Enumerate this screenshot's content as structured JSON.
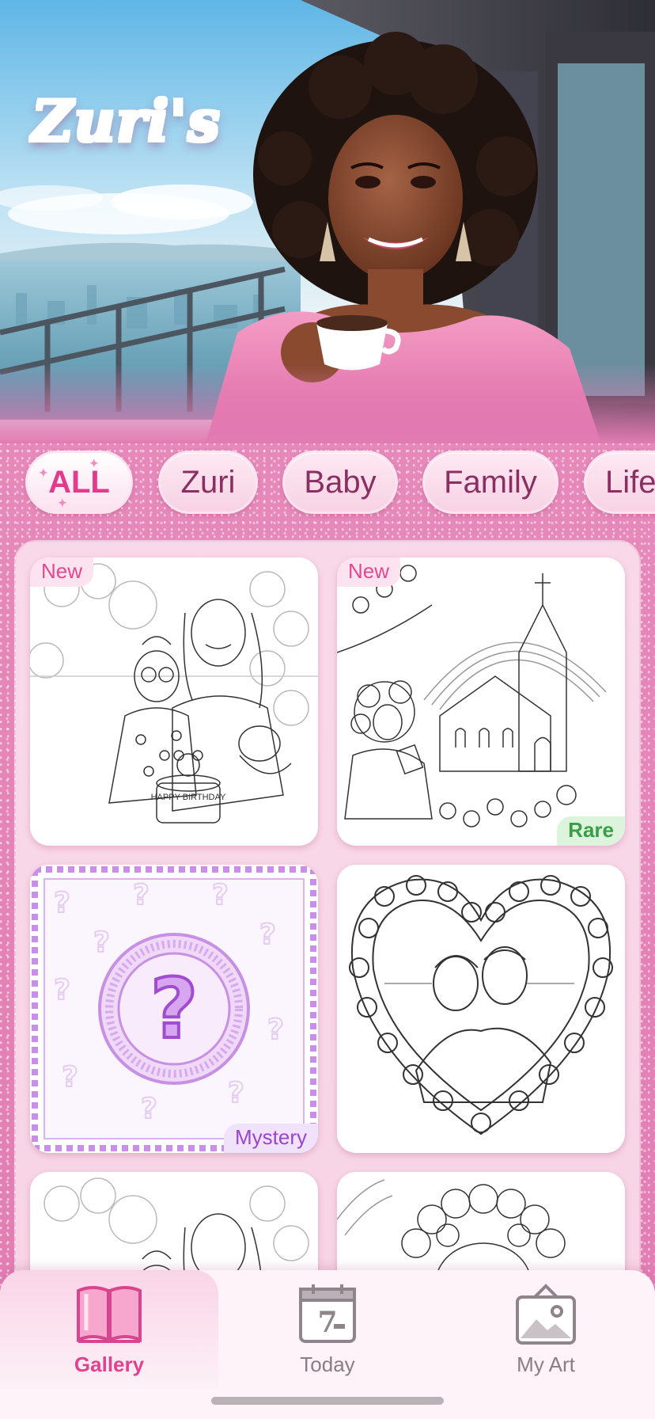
{
  "app": {
    "brand_title": "Zuri's"
  },
  "categories": [
    {
      "label": "ALL",
      "active": true
    },
    {
      "label": "Zuri",
      "active": false
    },
    {
      "label": "Baby",
      "active": false
    },
    {
      "label": "Family",
      "active": false
    },
    {
      "label": "Life",
      "active": false
    }
  ],
  "gallery": {
    "cards": [
      {
        "subject": "birthday-family-page",
        "badge": "New"
      },
      {
        "subject": "church-reading-page",
        "badge_top": "New",
        "badge_bottom": "Rare"
      },
      {
        "subject": "mystery-page",
        "badge": "Mystery",
        "symbol": "?"
      },
      {
        "subject": "heart-roses-couple-page"
      },
      {
        "subject": "family-page-2"
      },
      {
        "subject": "curly-hair-portrait-page"
      }
    ],
    "cake_text": "HAPPY BIRTHDAY"
  },
  "tabbar": {
    "tabs": [
      {
        "label": "Gallery",
        "icon": "book-icon",
        "active": true
      },
      {
        "label": "Today",
        "icon": "calendar-icon",
        "calendar_day": "7",
        "active": false
      },
      {
        "label": "My Art",
        "icon": "picture-frame-icon",
        "active": false
      }
    ]
  },
  "colors": {
    "accent": "#e0428f",
    "glitter_pink": "#e17cb3",
    "rare_green": "#3b9d47",
    "mystery_purple": "#9a46c9"
  }
}
